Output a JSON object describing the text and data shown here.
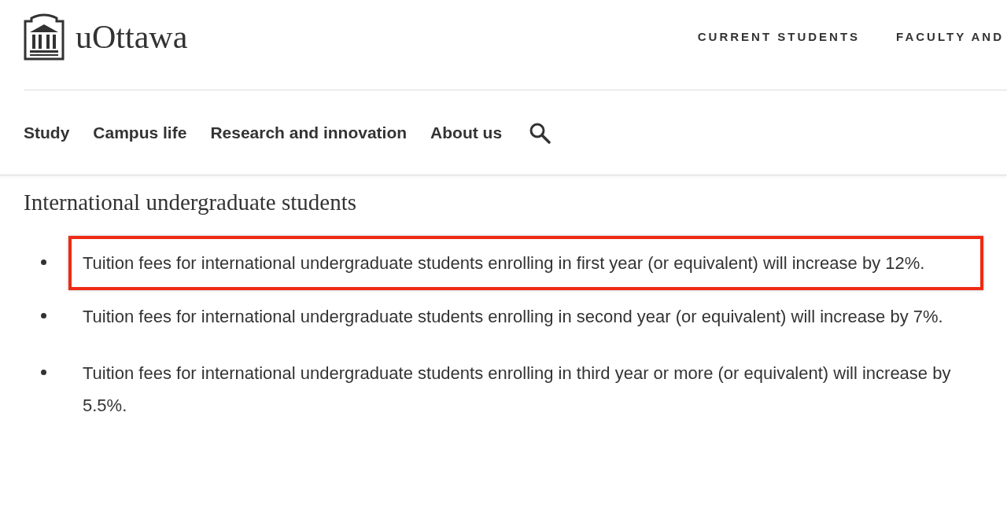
{
  "header": {
    "logo_text": "uOttawa",
    "utility_links": [
      "CURRENT STUDENTS",
      "FACULTY AND"
    ]
  },
  "main_nav": {
    "items": [
      "Study",
      "Campus life",
      "Research and innovation",
      "About us"
    ]
  },
  "section": {
    "heading": "International undergraduate students",
    "bullets": [
      {
        "text": "Tuition fees for international undergraduate students enrolling in first year (or equivalent) will increase by 12%.",
        "highlighted": true
      },
      {
        "text": "Tuition fees for international undergraduate students enrolling in second year (or equivalent) will increase by 7%.",
        "highlighted": false
      },
      {
        "text": "Tuition fees for international undergraduate students enrolling in third year or more (or equivalent) will increase by 5.5%.",
        "highlighted": false
      }
    ]
  }
}
